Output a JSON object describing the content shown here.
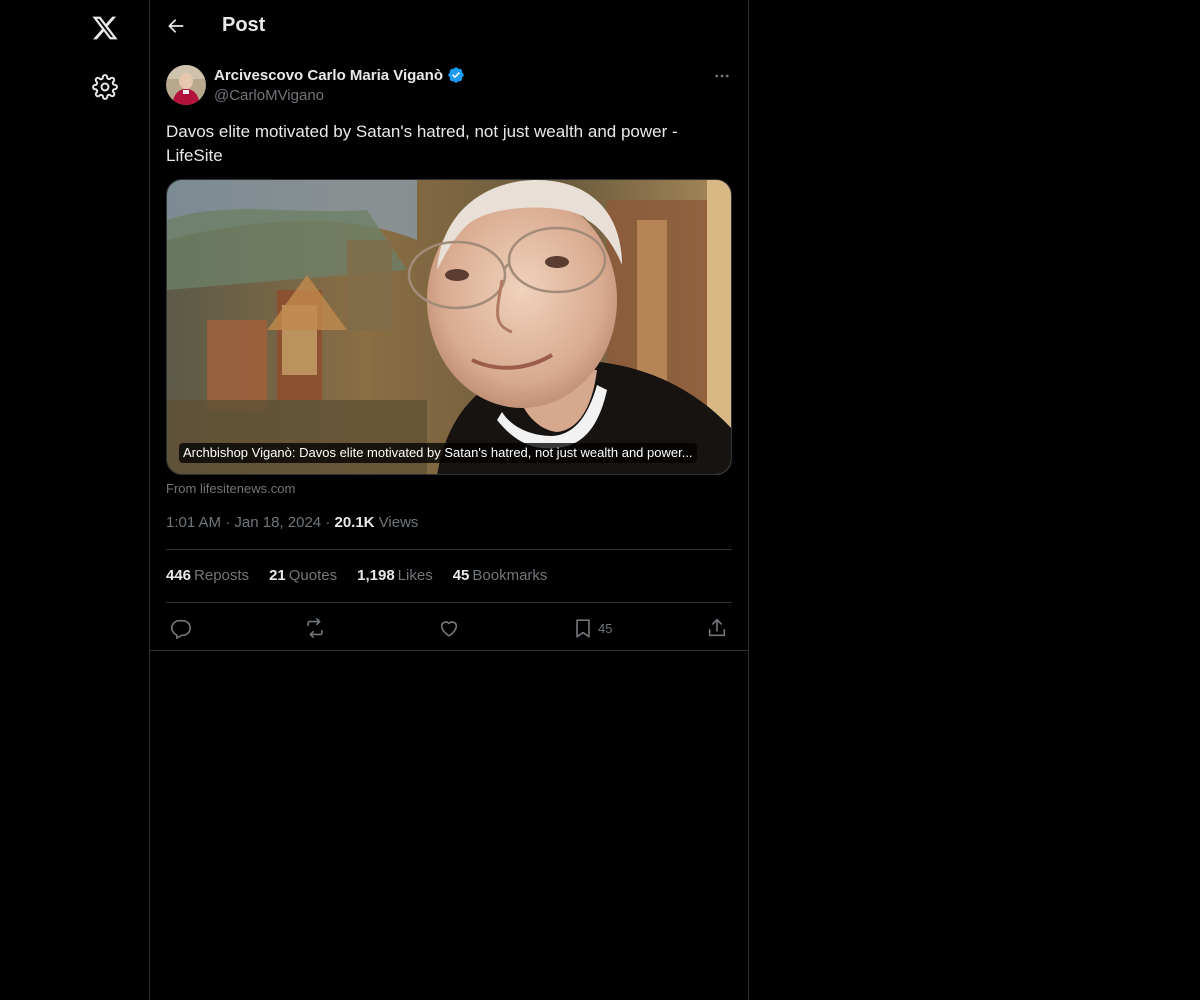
{
  "rail": {
    "logo_icon": "x-logo-icon",
    "settings_icon": "gear-icon"
  },
  "header": {
    "back_icon": "arrow-left-icon",
    "title": "Post"
  },
  "post": {
    "author": {
      "name": "Arcivescovo Carlo Maria Viganò",
      "handle": "@CarloMVigano",
      "verified": true,
      "verified_color": "#1d9bf0"
    },
    "more_icon": "more-horizontal-icon",
    "text": "Davos elite motivated by Satan's hatred, not just wealth and power - LifeSite",
    "card": {
      "caption": "Archbishop Viganò: Davos elite motivated by Satan's hatred, not just wealth and power...",
      "source": "From lifesitenews.com"
    },
    "time": "1:01 AM",
    "date": "Jan 18, 2024",
    "views_count": "20.1K",
    "views_label": "Views",
    "stats": [
      {
        "count": "446",
        "label": "Reposts"
      },
      {
        "count": "21",
        "label": "Quotes"
      },
      {
        "count": "1,198",
        "label": "Likes"
      },
      {
        "count": "45",
        "label": "Bookmarks"
      }
    ],
    "actions": {
      "reply_icon": "reply-icon",
      "repost_icon": "repost-icon",
      "like_icon": "heart-icon",
      "bookmark_icon": "bookmark-icon",
      "bookmark_count": "45",
      "share_icon": "share-icon"
    }
  },
  "colors": {
    "background": "#000000",
    "text_primary": "#e7e9ea",
    "text_secondary": "#71767b",
    "border": "#2f3336",
    "accent": "#1d9bf0"
  }
}
